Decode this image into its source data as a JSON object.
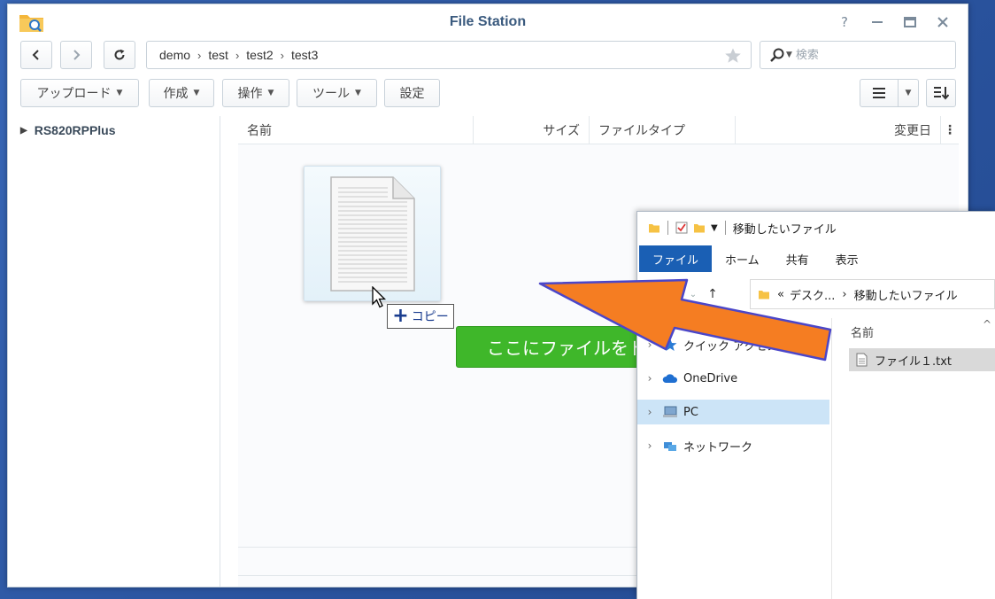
{
  "file_station": {
    "title": "File Station",
    "breadcrumb": [
      "demo",
      "test",
      "test2",
      "test3"
    ],
    "search_placeholder": "検索",
    "toolbar": {
      "upload": "アップロード",
      "create": "作成",
      "action": "操作",
      "tools": "ツール",
      "settings": "設定"
    },
    "tree_root": "RS820RPPlus",
    "columns": {
      "name": "名前",
      "size": "サイズ",
      "type": "ファイルタイプ",
      "modified": "変更日"
    },
    "copy_tooltip": "コピー",
    "drop_banner": "ここにファイルをド"
  },
  "explorer": {
    "title": "移動したいファイル",
    "ribbon_tabs": [
      "ファイル",
      "ホーム",
      "共有",
      "表示"
    ],
    "address": {
      "prefix": "«",
      "parent": "デスク...",
      "current": "移動したいファイル"
    },
    "nav_items": [
      {
        "label": "クイック アクセス",
        "icon": "star-icon"
      },
      {
        "label": "OneDrive",
        "icon": "cloud-icon"
      },
      {
        "label": "PC",
        "icon": "pc-icon"
      },
      {
        "label": "ネットワーク",
        "icon": "network-icon"
      }
    ],
    "column_name": "名前",
    "file_name": "ファイル１.txt"
  },
  "colors": {
    "drop_green": "#3fb72a",
    "arrow_orange": "#f57d22",
    "arrow_outline": "#4b46c8",
    "ribbon_blue": "#1a5fb4",
    "selection_blue": "#cce4f7"
  }
}
